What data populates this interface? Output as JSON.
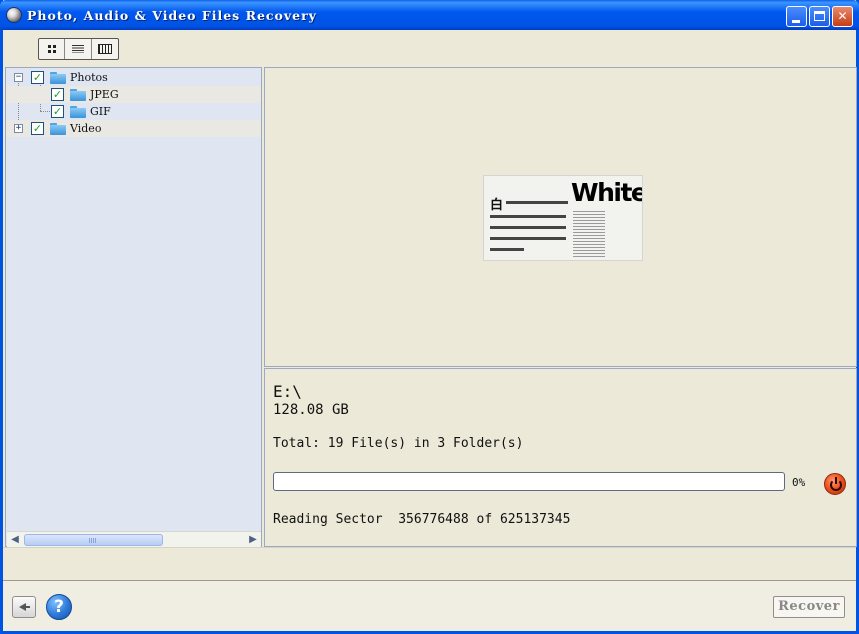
{
  "window": {
    "title": "Photo, Audio & Video Files Recovery"
  },
  "toolbar": {
    "view_buttons": [
      {
        "icon": "thumbnails-icon"
      },
      {
        "icon": "list-icon"
      },
      {
        "icon": "filmstrip-icon"
      }
    ]
  },
  "tree": {
    "items": [
      {
        "label": "Photos",
        "expander": "−",
        "checked": true,
        "level": 0
      },
      {
        "label": "JPEG",
        "checked": true,
        "level": 1
      },
      {
        "label": "GIF",
        "checked": true,
        "level": 1
      },
      {
        "label": "Video",
        "expander": "+",
        "checked": true,
        "level": 0
      }
    ],
    "check_mark": "✓"
  },
  "scrollbar": {
    "left_arrow": "◀",
    "right_arrow": "▶"
  },
  "preview": {
    "thumbnail_title": "White",
    "thumbnail_glyph": "白"
  },
  "info": {
    "drive": "E:\\",
    "size": "128.08 GB",
    "total": "Total: 19 File(s) in 3 Folder(s)",
    "progress_percent": 0,
    "progress_label": "0%",
    "reading": "Reading Sector  356776488 of 625137345"
  },
  "footer": {
    "help_label": "?",
    "recover_label": "Recover"
  },
  "colors": {
    "titlebar": "#0058ee",
    "window_bg": "#ece9d8",
    "tree_bg": "#dfe6f2",
    "stop_button": "#f0541d"
  }
}
